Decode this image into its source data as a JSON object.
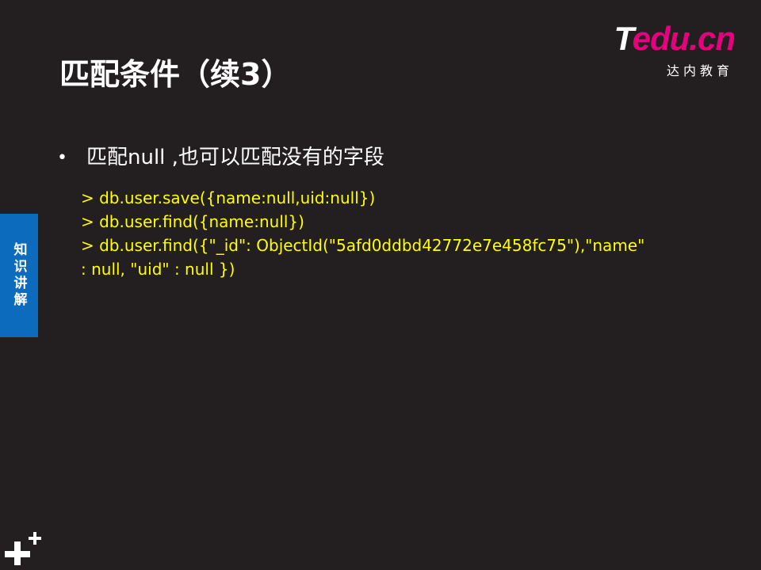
{
  "slide": {
    "title": "匹配条件（续3）",
    "logo": {
      "brand_t": "T",
      "brand_rest": "edu.cn",
      "subtitle": "达内教育"
    },
    "side_tab": {
      "label": "知识讲解",
      "color": "#0d6bbd"
    },
    "bullet": {
      "marker": "•",
      "text": "匹配null ,也可以匹配没有的字段"
    },
    "code_lines": [
      "> db.user.save({name:null,uid:null})",
      "> db.user.find({name:null})",
      "> db.user.find({\"_id\": ObjectId(\"5afd0ddbd42772e7e458fc75\"),\"name\"  : null, \"uid\" : null })"
    ],
    "colors": {
      "background": "#231f20",
      "code": "#ffff00",
      "brand_accent": "#e6007e"
    }
  }
}
